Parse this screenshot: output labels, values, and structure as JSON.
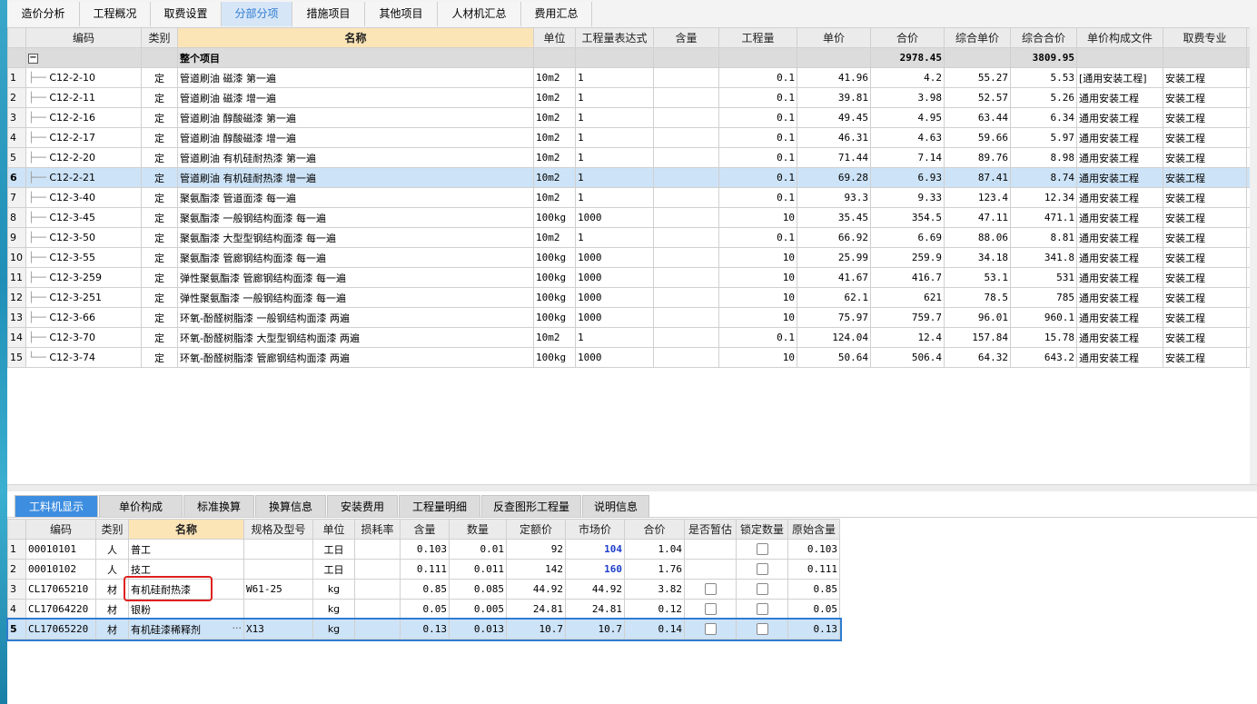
{
  "top_tabs": [
    {
      "label": "造价分析",
      "w": 80
    },
    {
      "label": "工程概况",
      "w": 78
    },
    {
      "label": "取费设置",
      "w": 78
    },
    {
      "label": "分部分项",
      "w": 78,
      "active": true
    },
    {
      "label": "措施项目",
      "w": 80
    },
    {
      "label": "其他项目",
      "w": 80
    },
    {
      "label": "人材机汇总",
      "w": 92
    },
    {
      "label": "费用汇总",
      "w": 78
    }
  ],
  "upper": {
    "headers": [
      "",
      "编码",
      "类别",
      "名称",
      "单位",
      "工程量表达式",
      "含量",
      "工程量",
      "单价",
      "合价",
      "综合单价",
      "综合合价",
      "单价构成文件",
      "取费专业",
      ""
    ],
    "group": {
      "label": "整个项目",
      "total": "2978.45",
      "comp_total": "3809.95"
    },
    "rows": [
      {
        "n": "1",
        "code": "C12-2-10",
        "type": "定",
        "name": "管道刷油 磁漆 第一遍",
        "unit": "10m2",
        "expr": "1",
        "qty": "0.1",
        "price": "41.96",
        "total": "4.2",
        "cprice": "55.27",
        "ctotal": "5.53",
        "file": "[通用安装工程]",
        "spec": "安装工程"
      },
      {
        "n": "2",
        "code": "C12-2-11",
        "type": "定",
        "name": "管道刷油 磁漆 增一遍",
        "unit": "10m2",
        "expr": "1",
        "qty": "0.1",
        "price": "39.81",
        "total": "3.98",
        "cprice": "52.57",
        "ctotal": "5.26",
        "file": "通用安装工程",
        "spec": "安装工程"
      },
      {
        "n": "3",
        "code": "C12-2-16",
        "type": "定",
        "name": "管道刷油 醇酸磁漆 第一遍",
        "unit": "10m2",
        "expr": "1",
        "qty": "0.1",
        "price": "49.45",
        "total": "4.95",
        "cprice": "63.44",
        "ctotal": "6.34",
        "file": "通用安装工程",
        "spec": "安装工程"
      },
      {
        "n": "4",
        "code": "C12-2-17",
        "type": "定",
        "name": "管道刷油 醇酸磁漆 增一遍",
        "unit": "10m2",
        "expr": "1",
        "qty": "0.1",
        "price": "46.31",
        "total": "4.63",
        "cprice": "59.66",
        "ctotal": "5.97",
        "file": "通用安装工程",
        "spec": "安装工程"
      },
      {
        "n": "5",
        "code": "C12-2-20",
        "type": "定",
        "name": "管道刷油 有机硅耐热漆 第一遍",
        "unit": "10m2",
        "expr": "1",
        "qty": "0.1",
        "price": "71.44",
        "total": "7.14",
        "cprice": "89.76",
        "ctotal": "8.98",
        "file": "通用安装工程",
        "spec": "安装工程"
      },
      {
        "n": "6",
        "code": "C12-2-21",
        "type": "定",
        "name": "管道刷油 有机硅耐热漆 增一遍",
        "unit": "10m2",
        "expr": "1",
        "qty": "0.1",
        "price": "69.28",
        "total": "6.93",
        "cprice": "87.41",
        "ctotal": "8.74",
        "file": "通用安装工程",
        "spec": "安装工程",
        "selected": true
      },
      {
        "n": "7",
        "code": "C12-3-40",
        "type": "定",
        "name": "聚氨酯漆 管道面漆 每一遍",
        "unit": "10m2",
        "expr": "1",
        "qty": "0.1",
        "price": "93.3",
        "total": "9.33",
        "cprice": "123.4",
        "ctotal": "12.34",
        "file": "通用安装工程",
        "spec": "安装工程"
      },
      {
        "n": "8",
        "code": "C12-3-45",
        "type": "定",
        "name": "聚氨酯漆 一般钢结构面漆 每一遍",
        "unit": "100kg",
        "expr": "1000",
        "qty": "10",
        "price": "35.45",
        "total": "354.5",
        "cprice": "47.11",
        "ctotal": "471.1",
        "file": "通用安装工程",
        "spec": "安装工程"
      },
      {
        "n": "9",
        "code": "C12-3-50",
        "type": "定",
        "name": "聚氨酯漆 大型型钢结构面漆 每一遍",
        "unit": "10m2",
        "expr": "1",
        "qty": "0.1",
        "price": "66.92",
        "total": "6.69",
        "cprice": "88.06",
        "ctotal": "8.81",
        "file": "通用安装工程",
        "spec": "安装工程"
      },
      {
        "n": "10",
        "code": "C12-3-55",
        "type": "定",
        "name": "聚氨酯漆 管廊钢结构面漆 每一遍",
        "unit": "100kg",
        "expr": "1000",
        "qty": "10",
        "price": "25.99",
        "total": "259.9",
        "cprice": "34.18",
        "ctotal": "341.8",
        "file": "通用安装工程",
        "spec": "安装工程"
      },
      {
        "n": "11",
        "code": "C12-3-259",
        "type": "定",
        "name": "弹性聚氨酯漆 管廊钢结构面漆 每一遍",
        "unit": "100kg",
        "expr": "1000",
        "qty": "10",
        "price": "41.67",
        "total": "416.7",
        "cprice": "53.1",
        "ctotal": "531",
        "file": "通用安装工程",
        "spec": "安装工程"
      },
      {
        "n": "12",
        "code": "C12-3-251",
        "type": "定",
        "name": "弹性聚氨酯漆 一般钢结构面漆 每一遍",
        "unit": "100kg",
        "expr": "1000",
        "qty": "10",
        "price": "62.1",
        "total": "621",
        "cprice": "78.5",
        "ctotal": "785",
        "file": "通用安装工程",
        "spec": "安装工程"
      },
      {
        "n": "13",
        "code": "C12-3-66",
        "type": "定",
        "name": "环氧-酚醛树脂漆 一般钢结构面漆 两遍",
        "unit": "100kg",
        "expr": "1000",
        "qty": "10",
        "price": "75.97",
        "total": "759.7",
        "cprice": "96.01",
        "ctotal": "960.1",
        "file": "通用安装工程",
        "spec": "安装工程"
      },
      {
        "n": "14",
        "code": "C12-3-70",
        "type": "定",
        "name": "环氧-酚醛树脂漆 大型型钢结构面漆 两遍",
        "unit": "10m2",
        "expr": "1",
        "qty": "0.1",
        "price": "124.04",
        "total": "12.4",
        "cprice": "157.84",
        "ctotal": "15.78",
        "file": "通用安装工程",
        "spec": "安装工程"
      },
      {
        "n": "15",
        "code": "C12-3-74",
        "type": "定",
        "name": "环氧-酚醛树脂漆 管廊钢结构面漆 两遍",
        "unit": "100kg",
        "expr": "1000",
        "qty": "10",
        "price": "50.64",
        "total": "506.4",
        "cprice": "64.32",
        "ctotal": "643.2",
        "file": "通用安装工程",
        "spec": "安装工程"
      }
    ]
  },
  "bottom_tabs": [
    {
      "label": "工料机显示",
      "active": true
    },
    {
      "label": "单价构成"
    },
    {
      "label": "标准换算"
    },
    {
      "label": "换算信息"
    },
    {
      "label": "安装费用"
    },
    {
      "label": "工程量明细"
    },
    {
      "label": "反查图形工程量"
    },
    {
      "label": "说明信息"
    }
  ],
  "lower": {
    "headers": [
      "",
      "编码",
      "类别",
      "名称",
      "规格及型号",
      "单位",
      "损耗率",
      "含量",
      "数量",
      "定额价",
      "市场价",
      "合价",
      "是否暂估",
      "锁定数量",
      "原始含量"
    ],
    "rows": [
      {
        "n": "1",
        "code": "00010101",
        "type": "人",
        "name": "普工",
        "model": "",
        "unit": "工日",
        "loss": "",
        "content": "0.103",
        "qty": "0.01",
        "quota": "92",
        "market": "104",
        "market_blue": true,
        "total": "1.04",
        "est": false,
        "lock": true,
        "orig": "0.103"
      },
      {
        "n": "2",
        "code": "00010102",
        "type": "人",
        "name": "技工",
        "model": "",
        "unit": "工日",
        "loss": "",
        "content": "0.111",
        "qty": "0.011",
        "quota": "142",
        "market": "160",
        "market_blue": true,
        "total": "1.76",
        "est": false,
        "lock": true,
        "orig": "0.111"
      },
      {
        "n": "3",
        "code": "CL17065210",
        "type": "材",
        "name": "有机硅耐热漆",
        "model": "W61-25",
        "unit": "kg",
        "loss": "",
        "content": "0.85",
        "qty": "0.085",
        "quota": "44.92",
        "market": "44.92",
        "total": "3.82",
        "est": true,
        "lock": true,
        "orig": "0.85"
      },
      {
        "n": "4",
        "code": "CL17064220",
        "type": "材",
        "name": "银粉",
        "model": "",
        "unit": "kg",
        "loss": "",
        "content": "0.05",
        "qty": "0.005",
        "quota": "24.81",
        "market": "24.81",
        "total": "0.12",
        "est": true,
        "lock": true,
        "orig": "0.05"
      },
      {
        "n": "5",
        "code": "CL17065220",
        "type": "材",
        "name": "有机硅漆稀释剂",
        "model": "X13",
        "unit": "kg",
        "loss": "",
        "content": "0.13",
        "qty": "0.013",
        "quota": "10.7",
        "market": "10.7",
        "total": "0.14",
        "est": true,
        "lock": true,
        "orig": "0.13",
        "selected": true,
        "ellipsis": "···"
      }
    ]
  }
}
